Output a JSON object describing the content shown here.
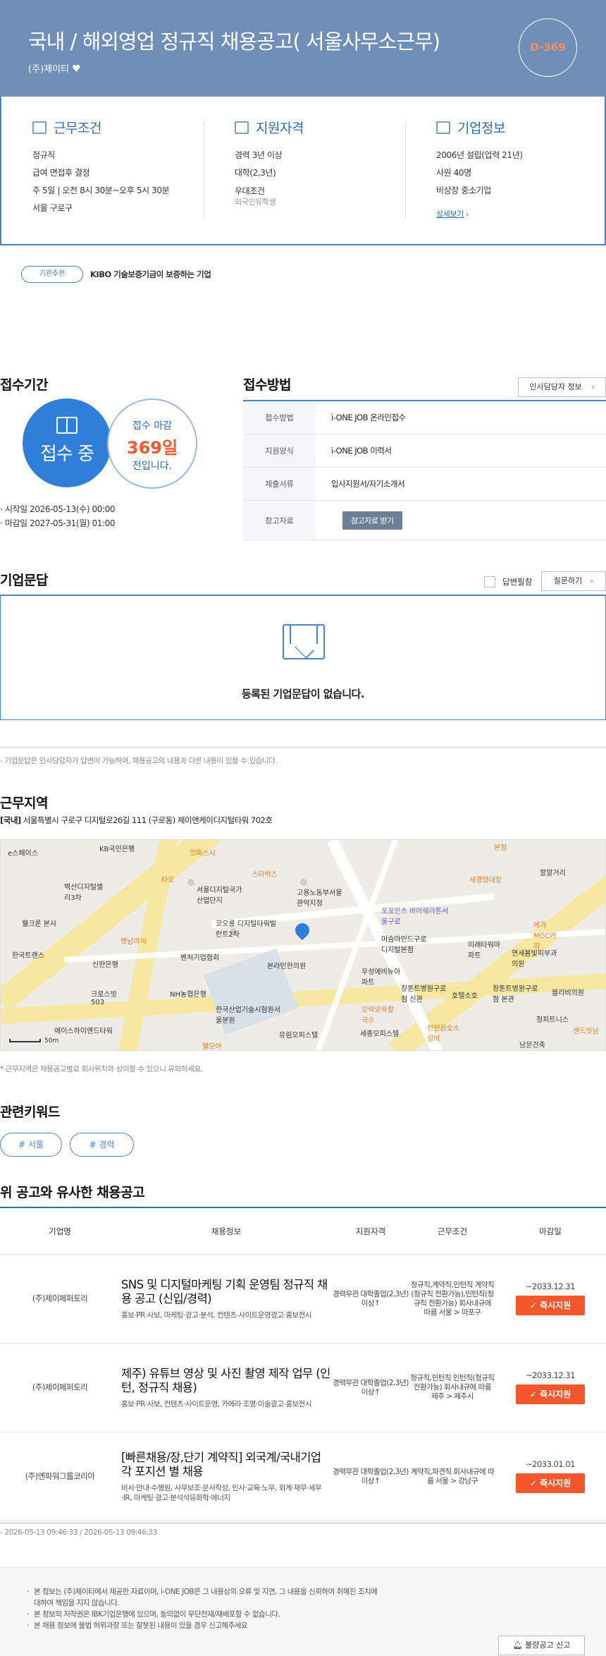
{
  "header": {
    "title": "국내 / 해외영업 정규직 채용공고( 서울사무소근무)",
    "company": "(주)제이티",
    "dday": "D-369"
  },
  "info": {
    "work": {
      "title": "근무조건",
      "lines": [
        "정규직",
        "급여 면접후 결정",
        "주 5일 | 오전 8시 30분~오후 5시 30분",
        "서울 구로구"
      ]
    },
    "qual": {
      "title": "지원자격",
      "lines": [
        "경력 3년 이상",
        "대학(2,3년)",
        "우대조건"
      ],
      "sub": "외국인유학생"
    },
    "company": {
      "title": "기업정보",
      "lines": [
        "2006년 설립(업력 21년)",
        "사원 40명",
        "비상장 중소기업"
      ],
      "detail_link": "상세보기"
    }
  },
  "recommend": {
    "badge": "기관추천",
    "text": "KIBO 기술보증기금이 보증하는 기업"
  },
  "period": {
    "title": "접수기간",
    "status": "접수 중",
    "deadline_label": "접수 마감",
    "days": "369일",
    "days_suffix": "전입니다.",
    "start": "시작일 2026-05-13(수) 00:00",
    "end": "마감일 2027-05-31(월) 01:00"
  },
  "method": {
    "title": "접수방법",
    "hr_button": "인사담당자 정보",
    "rows": [
      {
        "label": "접수방법",
        "value": "i-ONE JOB 온라인접수"
      },
      {
        "label": "지원양식",
        "value": "i-ONE JOB 이력서"
      },
      {
        "label": "제출서류",
        "value": "입사지원서/자기소개서"
      },
      {
        "label": "참고자료",
        "button": "참고자료 받기"
      }
    ]
  },
  "qa": {
    "title": "기업문답",
    "answered_label": "답변필참",
    "ask_button": "질문하기",
    "empty": "등록된 기업문답이 없습니다.",
    "note": "- 기업문답은 인사담당자가 답변이 가능하며, 채용공고의 내용과 다른 내용이 있을 수 있습니다."
  },
  "location": {
    "title": "근무지역",
    "tag": "[국내]",
    "address": "서울특별시 구로구 디지털로26길 111 (구로동) 제이앤케이디지털타워 702호",
    "note": "* 근무지역은 채용공고별로 회사위치와 상이할 수 있으니 유의하세요.",
    "map_labels": [
      "e스페이스",
      "KB국민은행",
      "갓파스시",
      "본점",
      "깔깔거리",
      "벽산디지털밸리3차",
      "타오",
      "서울디지털국가산업단지",
      "스타벅스",
      "세광양대창",
      "고용노동부서울관악지청",
      "웰크론 본사",
      "코오롱 디지털타워빌란트2차",
      "포포인츠 바이쉐라톤서울구로",
      "메가MGC커피",
      "벳남미식",
      "머슴마인드구로디지털본점",
      "미래타워아파트",
      "연세봄빛피부과의원",
      "한국트랜스",
      "신한은행",
      "벤처기업협회",
      "본라인한의원",
      "우성에비뉴아파트",
      "창톤트병원구로점 신관",
      "호텔소호",
      "창톤트병원구로점 본관",
      "블리비의원",
      "크로스빗503",
      "NH농협은행",
      "한국산업기술시험원서울분원",
      "모락모락칼국수",
      "정피트니스",
      "에이스하이엔드타워",
      "유림오피스텔",
      "세종오피스텔",
      "한판참숯소갈비",
      "남문건축",
      "샌드잇남",
      "웰모어",
      "50m"
    ],
    "map_scale": "50m"
  },
  "keywords": {
    "title": "관련키워드",
    "items": [
      "# 서울",
      "# 경력"
    ]
  },
  "similar": {
    "title": "위 공고와 유사한 채용공고",
    "columns": [
      "기업명",
      "채용정보",
      "지원자격",
      "근무조건",
      "마감일"
    ],
    "rows": [
      {
        "company": "(주)제이페퍼토리",
        "title": "SNS 및 디지털마케팅 기획 운영팀 정규직 채용 공고 (신입/경력)",
        "desc": "홍보·PR·사보, 마케팅·광고·분석, 컨텐츠·사이트운영광고·홍보전시",
        "qual": "경력무관 대학졸업(2,3년) 이상↑",
        "cond": "정규직,계약직,인턴직 계약직(정규직 전환가능),인턴직(정규직 전환가능) 회사내규에 따름 서울 > 마포구",
        "deadline": "~2033.12.31",
        "apply": "즉시지원"
      },
      {
        "company": "(주)제이페퍼토리",
        "title": "제주) 유튜브 영상 및 사진 촬영 제작 업무 (인턴, 정규직 채용)",
        "desc": "홍보·PR·사보, 컨텐츠·사이트운영, 카메라·조명·미술광고·홍보전시",
        "qual": "경력무관 대학졸업(2,3년) 이상↑",
        "cond": "정규직,인턴직 인턴직(정규직 전환가능) 회사내규에 따름 제주 > 제주시",
        "deadline": "~2033.12.31",
        "apply": "즉시지원"
      },
      {
        "company": "(주)엔파워그룹코리아",
        "title": "[빠른채용/장,단기 계약직] 외국계/국내기업 각 포지션 별 채용",
        "desc": "비서·안내·수행원, 사무보조·문서작성, 인사·교육·노무, 회계·재무·세무·IR, 마케팅·광고·분석석유화학·에너지",
        "qual": "경력무관 대학졸업(2,3년) 이상↑",
        "cond": "계약직,파견직 회사내규에 따름 서울 > 강남구",
        "deadline": "~2033.01.01",
        "apply": "즉시지원"
      }
    ]
  },
  "timestamps": "- 2026-05-13 09:46:33 / 2026-05-13 09:46:33",
  "footer": {
    "lines": [
      "본 정보는 (주)제이티에서 제공한 자료이며, i-ONE JOB은 그 내용상의 오류 및 지연, 그 내용을 신뢰하여 취해진 조치에 대하여 책임을 지지 않습니다.",
      "본 정보의 저작권은 IBK기업은행에 있으며, 동의없이 무단전재/재배포할 수 없습니다.",
      "본 채용 정보에 불법 허위과장 또는 잘못된 내용이 있을 경우 신고해주세요"
    ],
    "report_button": "불량공고 신고"
  }
}
